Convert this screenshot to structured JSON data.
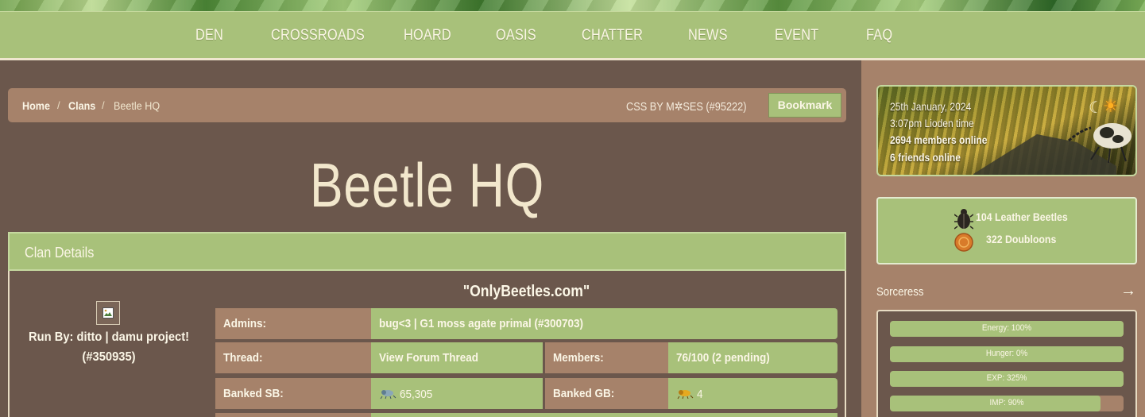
{
  "nav": {
    "items": [
      "DEN",
      "CROSSROADS",
      "HOARD",
      "OASIS",
      "CHATTER",
      "NEWS",
      "EVENT",
      "FAQ"
    ]
  },
  "breadcrumb": {
    "home": "Home",
    "sep1": "/",
    "clans": "Clans",
    "sep2": "/",
    "current": "Beetle HQ"
  },
  "css_credit": "CSS BY M✲SES (#95222)",
  "bookmark_label": "Bookmark",
  "page_title": "Beetle HQ",
  "clan": {
    "section_title": "Clan Details",
    "run_by": "Run By: ditto | damu project! (#350935)",
    "motto": "\"OnlyBeetles.com\"",
    "admins_label": "Admins:",
    "admins_value": "bug<3 | G1 moss agate primal (#300703)",
    "thread_label": "Thread:",
    "thread_value": "View Forum Thread",
    "members_label": "Members:",
    "members_value": "76/100 (2 pending)",
    "banked_sb_label": "Banked SB:",
    "banked_sb_value": "65,305",
    "banked_gb_label": "Banked GB:",
    "banked_gb_value": "4"
  },
  "sidebar": {
    "date": "25th January, 2024",
    "time": "3:07pm Lioden time",
    "members_online": "2694 members online",
    "friends_online": "6 friends online",
    "beetles": "104 Leather Beetles",
    "doubloons": "322 Doubloons",
    "pet_name": "Sorceress",
    "pet_arrow": "→",
    "stats": [
      {
        "label": "Energy: 100%",
        "value": 100
      },
      {
        "label": "Hunger: 0%",
        "value": 100
      },
      {
        "label": "EXP: 325%",
        "value": 100
      },
      {
        "label": "IMP: 90%",
        "value": 90
      }
    ]
  },
  "colors": {
    "brown_bg": "#6b574c",
    "tan": "#a6826a",
    "green": "#a8c17a",
    "cream": "#fbf6e6"
  }
}
